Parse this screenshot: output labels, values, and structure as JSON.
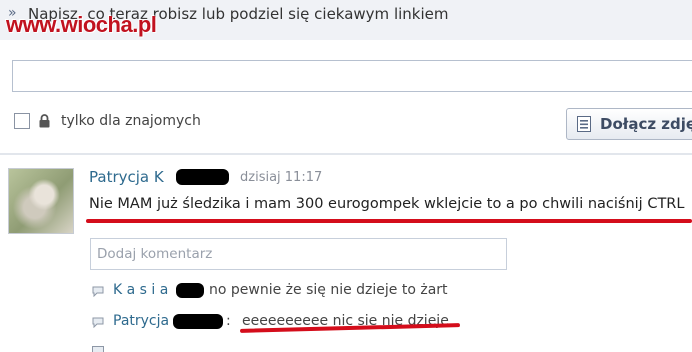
{
  "status_prompt": {
    "text": "Napisz, co teraz robisz lub podziel się ciekawym linkiem"
  },
  "watermark": {
    "text": "www.wiocha.pl"
  },
  "privacy": {
    "label": "tylko dla znajomych"
  },
  "join_button": {
    "label": "Dołącz zdję"
  },
  "post": {
    "author_first": "Patrycja",
    "author_partial": "K",
    "time": "dzisiaj 11:17",
    "text": "Nie MAM już śledzika i mam 300 eurogompek wklejcie to a po chwili naciśnij CTRL"
  },
  "comment_input": {
    "placeholder": "Dodaj komentarz"
  },
  "comments": [
    {
      "author": "K a s i a",
      "text": "no pewnie że się nie dzieje to żart"
    },
    {
      "author": "Patrycja",
      "separator": ":",
      "text": "eeeeeeeeee nic sie nie dzieje"
    }
  ],
  "icons": {
    "prompt": "chevron-right-icon",
    "lock": "lock-icon",
    "photo": "photo-icon",
    "comment": "comment-bubble-icon"
  },
  "colors": {
    "link": "#2e6a8e",
    "highlight": "#d40d1b",
    "watermark": "#c1121f"
  }
}
